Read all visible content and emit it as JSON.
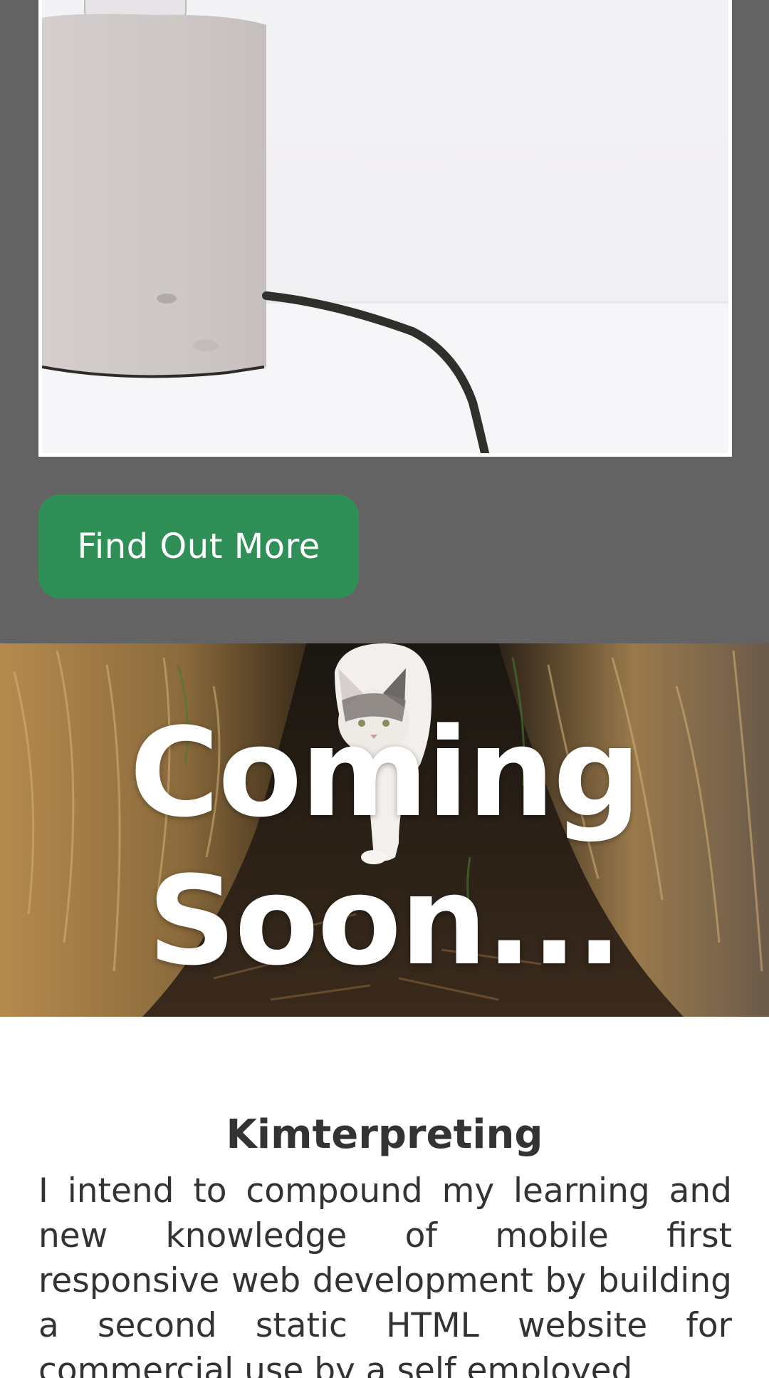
{
  "top_section": {
    "background_color": "#636363",
    "image": {
      "icon": "lamp-photo"
    },
    "cta_button": {
      "label": "Find Out More",
      "color": "#2f8f57"
    }
  },
  "hero": {
    "title": "Coming Soon...",
    "image": {
      "icon": "cat-in-straw-photo"
    }
  },
  "content": {
    "title": "Kimterpreting",
    "body": "I intend to compound my learning and new knowledge of mobile first responsive web development by building a second static HTML website for commercial use by a self employed"
  }
}
